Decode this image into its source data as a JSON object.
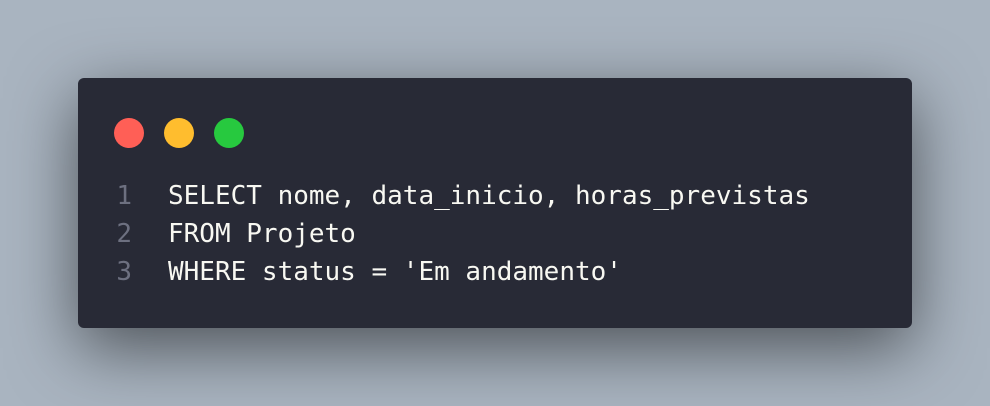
{
  "colors": {
    "background": "#a9b4c0",
    "window": "#282a36",
    "close": "#ff5f56",
    "minimize": "#ffbd2e",
    "maximize": "#27c93f",
    "text": "#f8f8f2",
    "line_number": "#6d7080"
  },
  "window_controls": [
    {
      "name": "close-dot-icon",
      "color": "#ff5f56"
    },
    {
      "name": "minimize-dot-icon",
      "color": "#ffbd2e"
    },
    {
      "name": "maximize-dot-icon",
      "color": "#27c93f"
    }
  ],
  "code": {
    "lines": [
      {
        "number": "1",
        "text": "SELECT nome, data_inicio, horas_previstas"
      },
      {
        "number": "2",
        "text": "FROM Projeto"
      },
      {
        "number": "3",
        "text": "WHERE status = 'Em andamento'"
      }
    ]
  }
}
